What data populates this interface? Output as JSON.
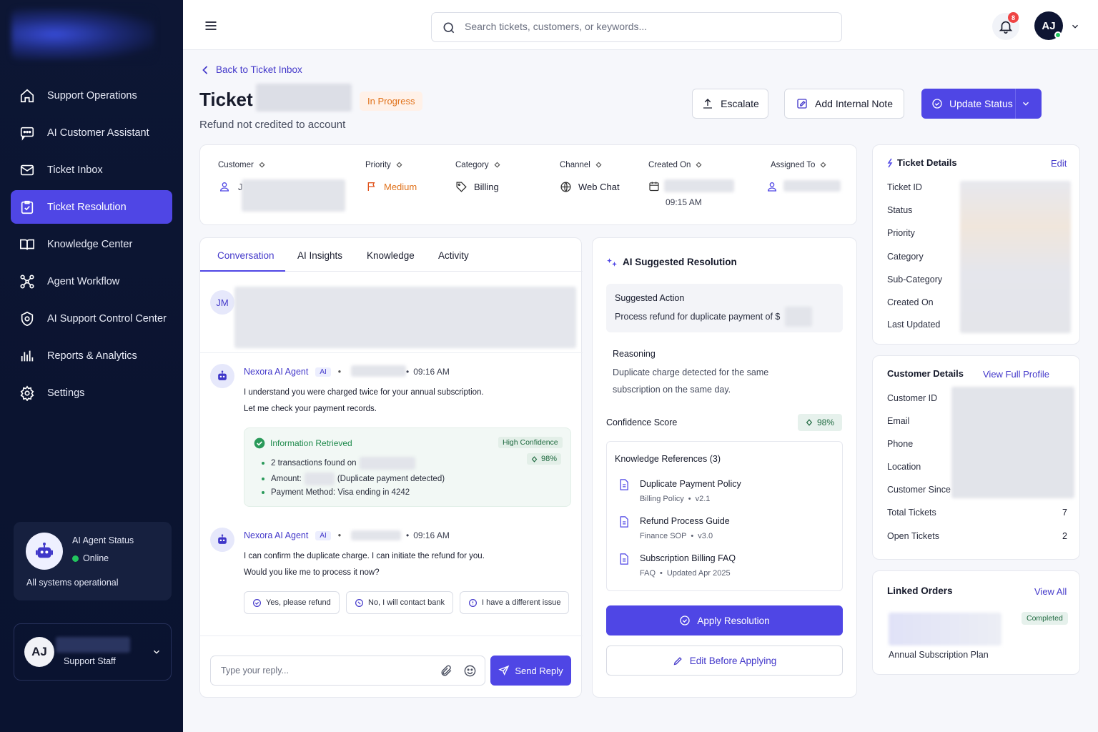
{
  "sidebar": {
    "nav": [
      {
        "label": "Support Operations",
        "icon": "home-icon"
      },
      {
        "label": "AI Customer Assistant",
        "icon": "chat-icon"
      },
      {
        "label": "Ticket Inbox",
        "icon": "mail-icon"
      },
      {
        "label": "Ticket Resolution",
        "icon": "clipboard-check-icon",
        "active": true
      },
      {
        "label": "Knowledge Center",
        "icon": "book-icon"
      },
      {
        "label": "Agent Workflow",
        "icon": "workflow-icon"
      },
      {
        "label": "AI Support Control Center",
        "icon": "target-icon"
      },
      {
        "label": "Reports & Analytics",
        "icon": "bar-chart-icon"
      },
      {
        "label": "Settings",
        "icon": "gear-icon"
      }
    ],
    "agent_status": {
      "title": "AI Agent Status",
      "state": "Online",
      "system": "All systems operational"
    },
    "user": {
      "initials": "AJ",
      "role": "Support Staff"
    }
  },
  "topbar": {
    "search_placeholder": "Search tickets, customers, or keywords...",
    "notification_count": "8",
    "avatar_initials": "AJ"
  },
  "header": {
    "back_label": "Back to Ticket Inbox",
    "title": "Ticket",
    "status": "In Progress",
    "subtitle": "Refund not credited to account",
    "escalate": "Escalate",
    "add_note": "Add Internal Note",
    "update_status": "Update Status"
  },
  "meta": {
    "customer_label": "Customer",
    "customer_initial": "J",
    "priority_label": "Priority",
    "priority": "Medium",
    "category_label": "Category",
    "category": "Billing",
    "channel_label": "Channel",
    "channel": "Web Chat",
    "created_label": "Created On",
    "created_time": "09:15 AM",
    "assigned_label": "Assigned To"
  },
  "conversation": {
    "tabs": [
      "Conversation",
      "AI Insights",
      "Knowledge",
      "Activity"
    ],
    "customer_initials": "JM",
    "msg1": {
      "agent": "Nexora AI Agent",
      "tag": "AI",
      "time": "09:16 AM",
      "line1": "I understand you were charged twice for your annual subscription.",
      "line2": "Let me check your payment records."
    },
    "info": {
      "title": "Information Retrieved",
      "confidence_label": "High Confidence",
      "confidence": "98%",
      "b1": "2 transactions found on",
      "b2a": "Amount:",
      "b2b": "(Duplicate payment detected)",
      "b3": "Payment Method: Visa ending in 4242"
    },
    "msg2": {
      "agent": "Nexora AI Agent",
      "tag": "AI",
      "time": "09:16 AM",
      "line1": "I can confirm the duplicate charge. I can initiate the refund for you.",
      "line2": "Would you like me to process it now?"
    },
    "chips": [
      "Yes, please refund",
      "No, I will contact bank",
      "I have a different issue"
    ],
    "reply_placeholder": "Type your reply...",
    "send": "Send Reply"
  },
  "ai_resolution": {
    "title": "AI Suggested Resolution",
    "action_label": "Suggested Action",
    "action_text": "Process refund for duplicate payment of $",
    "reasoning_label": "Reasoning",
    "reasoning_1": "Duplicate charge detected for the same",
    "reasoning_2": "subscription on the same day.",
    "confidence_label": "Confidence Score",
    "confidence": "98%",
    "refs_title": "Knowledge References (3)",
    "refs": [
      {
        "title": "Duplicate Payment Policy",
        "type": "Billing Policy",
        "meta": "v2.1"
      },
      {
        "title": "Refund Process Guide",
        "type": "Finance SOP",
        "meta": "v3.0"
      },
      {
        "title": "Subscription Billing FAQ",
        "type": "FAQ",
        "meta": "Updated Apr 2025"
      }
    ],
    "apply": "Apply Resolution",
    "edit": "Edit Before Applying"
  },
  "ticket_details": {
    "title": "Ticket Details",
    "edit": "Edit",
    "rows": [
      "Ticket ID",
      "Status",
      "Priority",
      "Category",
      "Sub-Category",
      "Created On",
      "Last Updated"
    ]
  },
  "customer_details": {
    "title": "Customer Details",
    "link": "View Full Profile",
    "rows": [
      "Customer ID",
      "Email",
      "Phone",
      "Location",
      "Customer Since",
      "Total Tickets",
      "Open Tickets"
    ],
    "total_tickets": "7",
    "open_tickets": "2"
  },
  "linked_orders": {
    "title": "Linked Orders",
    "link": "View All",
    "status": "Completed",
    "order": "Annual Subscription Plan"
  }
}
